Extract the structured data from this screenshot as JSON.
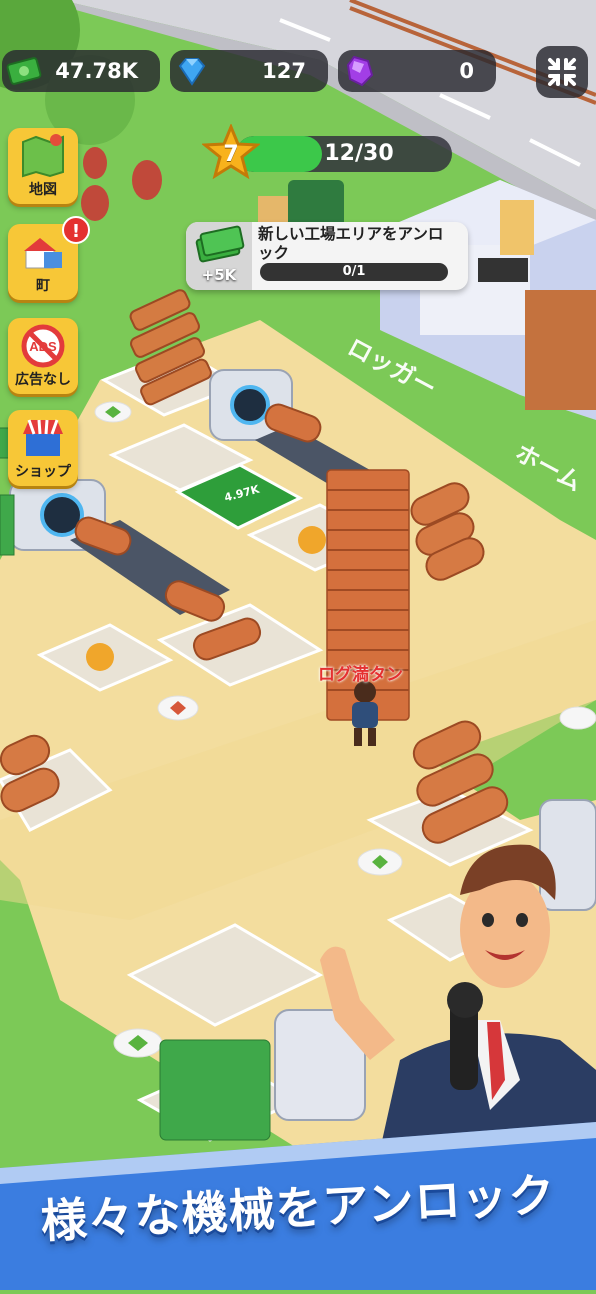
{
  "resources": {
    "cash": "47.78K",
    "gems": "127",
    "purple_gems": "0"
  },
  "level": {
    "number": "7",
    "progress_text": "12/30",
    "progress_fraction": 0.4
  },
  "quest": {
    "title": "新しい工場エリアをアンロック",
    "progress_text": "0/1",
    "reward": "+5K"
  },
  "side_menu": {
    "map": "地図",
    "town": "町",
    "no_ads": "広告なし",
    "shop": "ショップ",
    "alert": "!",
    "ads_badge": "ADS"
  },
  "world": {
    "logger_label": "ロッガー",
    "home_label": "ホーム",
    "log_full": "ログ満タン",
    "pad_amount": "4.97K"
  },
  "banner": {
    "text": "様々な機械をアンロック"
  },
  "colors": {
    "grass": "#7cc957",
    "sand": "#f4dfa0",
    "road": "#d9d9de",
    "accent_yellow": "#f7c737",
    "banner_blue": "#3b7de0"
  }
}
